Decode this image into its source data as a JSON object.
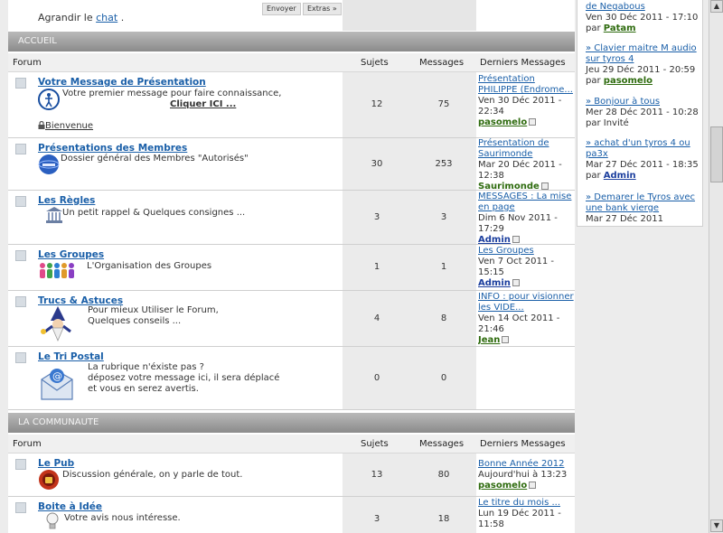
{
  "chat": {
    "text_prefix": "Agrandir le",
    "link": "chat",
    "suffix": ".",
    "send": "Envoyer",
    "extras": "Extras »"
  },
  "columns": {
    "forum": "Forum",
    "sujets": "Sujets",
    "messages": "Messages",
    "derniers": "Derniers Messages"
  },
  "categories": [
    {
      "title": "ACCUEIL",
      "forums": [
        {
          "title": "Votre Message de Présentation",
          "desc": [
            "Votre premier message pour faire connaissance,"
          ],
          "extra_link": "Cliquer ICI ...",
          "sublink": "Bienvenue",
          "sujets": "12",
          "messages": "75",
          "last_title": "Présentation PHILIPPE (Endrome...",
          "last_date": "Ven 30 Déc 2011 - 22:34",
          "last_author": "pasomelo",
          "author_color": "#2e6b0e"
        },
        {
          "title": "Présentations des Membres",
          "desc": [
            "Dossier général des Membres \"Autorisés\""
          ],
          "sujets": "30",
          "messages": "253",
          "last_title": "Présentation de Saurimonde",
          "last_date": "Mar 20 Déc 2011 - 12:38",
          "last_author": "Saurimonde",
          "author_color": "#2e6b0e"
        },
        {
          "title": "Les Règles",
          "desc": [
            "Un petit rappel & Quelques consignes ..."
          ],
          "sujets": "3",
          "messages": "3",
          "last_title": "MESSAGES : La mise en page",
          "last_date": "Dim 6 Nov 2011 - 17:29",
          "last_author": "Admin",
          "author_color": "#1c3f9e"
        },
        {
          "title": "Les Groupes",
          "desc": [
            "L'Organisation des Groupes"
          ],
          "sujets": "1",
          "messages": "1",
          "last_title": "Les Groupes",
          "last_date": "Ven 7 Oct 2011 - 15:15",
          "last_author": "Admin",
          "author_color": "#1c3f9e"
        },
        {
          "title": "Trucs & Astuces",
          "desc": [
            "Pour mieux Utiliser le Forum,",
            "Quelques conseils ..."
          ],
          "sujets": "4",
          "messages": "8",
          "last_title": "INFO : pour visionner les VIDE...",
          "last_date": "Ven 14 Oct 2011 - 21:46",
          "last_author": "Jean",
          "author_color": "#2e6b0e"
        },
        {
          "title": "Le Tri Postal",
          "desc": [
            "La rubrique n'éxiste pas ?",
            "déposez votre message ici, il sera déplacé",
            "et vous en serez avertis."
          ],
          "sujets": "0",
          "messages": "0",
          "last_title": "",
          "last_date": "",
          "last_author": ""
        }
      ]
    },
    {
      "title": "LA COMMUNAUTE",
      "forums": [
        {
          "title": "Le Pub",
          "desc": [
            "Discussion générale, on y parle de tout."
          ],
          "sujets": "13",
          "messages": "80",
          "last_title": "Bonne Année 2012",
          "last_date": "Aujourd'hui à 13:23",
          "last_author": "pasomelo",
          "author_color": "#2e6b0e"
        },
        {
          "title": "Boite à Idée",
          "desc": [
            "Votre avis nous intéresse."
          ],
          "sujets": "3",
          "messages": "18",
          "last_title": "Le titre du mois ...",
          "last_date": "Lun 19 Déc 2011 - 11:58",
          "last_author": "",
          "author_color": "#2e6b0e"
        }
      ]
    }
  ],
  "sidebar": {
    "items": [
      {
        "title": "de Negabous",
        "date": "Ven 30 Déc 2011 - 17:10 par",
        "author": "Patam",
        "author_color": "#2e6b0e"
      },
      {
        "title": "» Clavier maitre M audio sur tyros 4",
        "date": "Jeu 29 Déc 2011 - 20:59 par",
        "author": "pasomelo",
        "author_color": "#2e6b0e"
      },
      {
        "title": "» Bonjour à tous",
        "date": "Mer 28 Déc 2011 - 10:28 par Invité",
        "author": "",
        "author_color": ""
      },
      {
        "title": "» achat d'un tyros 4 ou pa3x",
        "date": "Mar 27 Déc 2011 - 18:35 par",
        "author": "Admin",
        "author_color": "#1c3f9e"
      },
      {
        "title": "» Demarer le Tyros avec une bank vierge",
        "date": "Mar 27 Déc 2011",
        "author": "",
        "author_color": ""
      }
    ]
  },
  "icons": {
    "legend": "legend-circle-icon",
    "lock": "lock-icon",
    "members": "members-globe-icon",
    "rules": "courthouse-icon",
    "groups": "people-group-icon",
    "tips": "wizard-icon",
    "mail": "email-icon",
    "pub": "pub-badge-icon",
    "idea": "lightbulb-icon",
    "goto": "goto-last-post-icon"
  },
  "colors": {
    "link": "#1a5fa8",
    "category_header": "#9b9b9b",
    "admin": "#1c3f9e",
    "member": "#2e6b0e"
  }
}
